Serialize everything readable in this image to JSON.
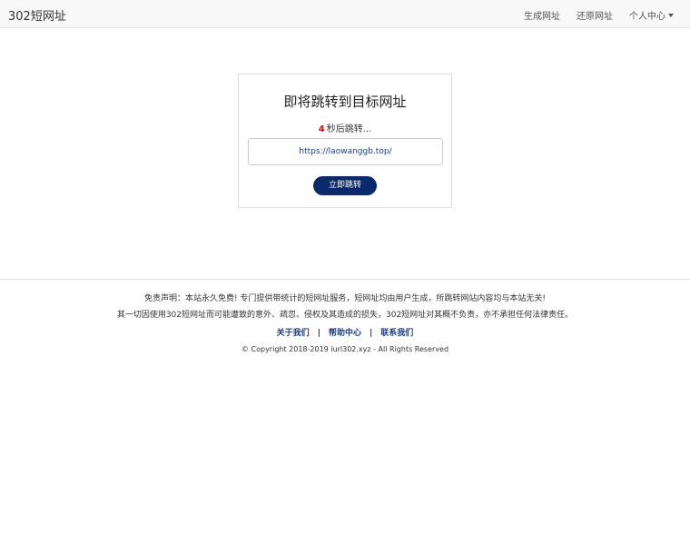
{
  "nav": {
    "brand": "302短网址",
    "links": [
      "生成网址",
      "还原网址",
      "个人中心"
    ]
  },
  "card": {
    "title": "即将跳转到目标网址",
    "count": "4",
    "count_suffix": "秒后跳转...",
    "url": "https://laowanggb.top/",
    "button_label": "立即跳转"
  },
  "footer": {
    "disclaimer_line1": "免责声明：本站永久免费! 专门提供带统计的短网址服务，短网址均由用户生成，所跳转网站内容均与本站无关!",
    "disclaimer_line2": "其一切因使用302短网址而可能遭致的意外、疏忽、侵权及其造成的损失，302短网址对其概不负责，亦不承担任何法律责任。",
    "links": [
      "关于我们",
      "帮助中心",
      "联系我们"
    ],
    "separator": "|",
    "copyright": "© Copyright 2018-2019 iurl302.xyz - All Rights Reserved"
  }
}
